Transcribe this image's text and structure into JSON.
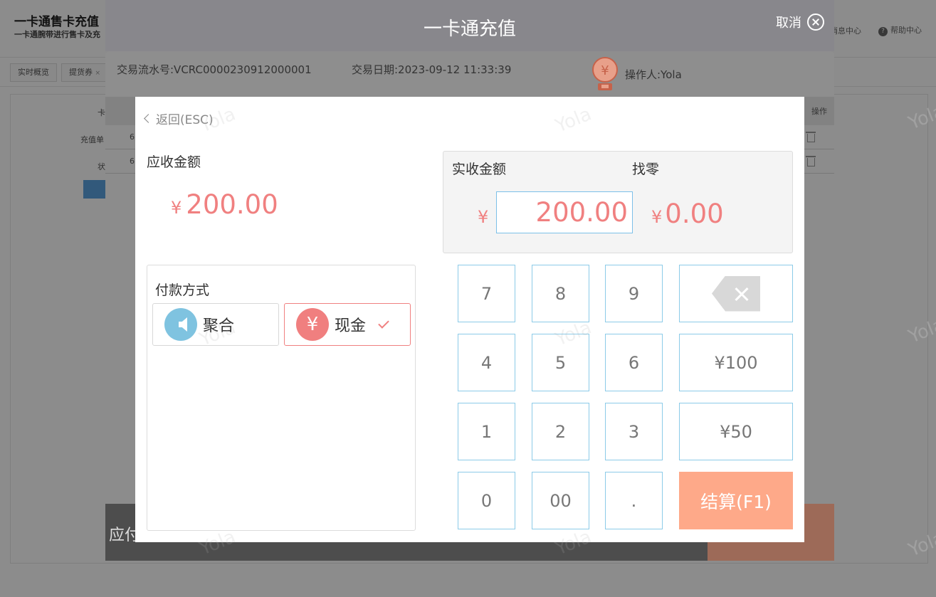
{
  "background": {
    "title": "一卡通售卡充值",
    "subtitle": "一卡通腕带进行售卡及充",
    "message_center": "消息中心",
    "help_center": "帮助中心",
    "tabs": [
      {
        "label": "实时概览"
      },
      {
        "label": "提货券"
      }
    ],
    "form_labels": [
      "卡",
      "充值单",
      "状"
    ],
    "row_values": [
      "6",
      "6"
    ]
  },
  "recharge": {
    "title": "一卡通充值",
    "cancel_label": "取消",
    "serial_label": "交易流水号:VCRC0000230912000001",
    "date_label": "交易日期:2023-09-12 11:33:39",
    "operator_label": "操作人:Yola",
    "table_op_header": "操作",
    "footer_left": "应付"
  },
  "payment": {
    "back_label": "返回(ESC)",
    "due_label": "应收金额",
    "currency_symbol": "¥",
    "due_amount": "200.00",
    "received_label": "实收金额",
    "change_label": "找零",
    "received_amount": "200.00",
    "change_amount": "0.00",
    "methods_title": "付款方式",
    "methods": [
      {
        "label": "聚合",
        "selected": false,
        "icon": "speaker-icon"
      },
      {
        "label": "现金",
        "selected": true,
        "icon": "yuan-icon"
      }
    ],
    "keypad": {
      "k7": "7",
      "k8": "8",
      "k9": "9",
      "k4": "4",
      "k5": "5",
      "k6": "6",
      "k1": "1",
      "k2": "2",
      "k3": "3",
      "k0": "0",
      "k00": "00",
      "kdot": ".",
      "k100": "¥100",
      "k50": "¥50",
      "settle": "结算(F1)"
    }
  },
  "watermark": "Yola",
  "colors": {
    "amount": "#f08080",
    "settle_button": "#fea989",
    "key_border": "#8ccbe8",
    "aggregate_icon": "#7fc3e0",
    "cash_icon": "#f07f7f"
  }
}
